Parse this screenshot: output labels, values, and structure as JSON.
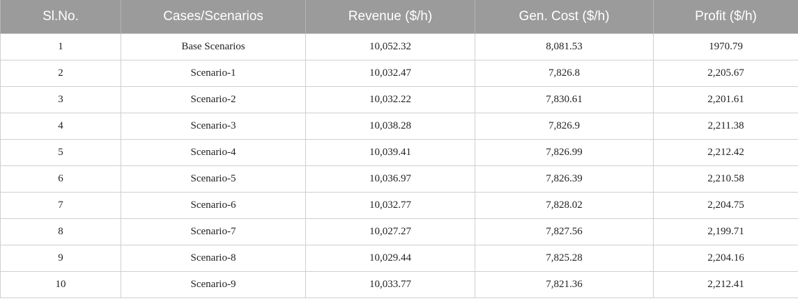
{
  "table": {
    "headers": [
      "Sl.No.",
      "Cases/Scenarios",
      "Revenue ($/h)",
      "Gen. Cost ($/h)",
      "Profit ($/h)"
    ],
    "rows": [
      [
        "1",
        "Base Scenarios",
        "10,052.32",
        "8,081.53",
        "1970.79"
      ],
      [
        "2",
        "Scenario-1",
        "10,032.47",
        "7,826.8",
        "2,205.67"
      ],
      [
        "3",
        "Scenario-2",
        "10,032.22",
        "7,830.61",
        "2,201.61"
      ],
      [
        "4",
        "Scenario-3",
        "10,038.28",
        "7,826.9",
        "2,211.38"
      ],
      [
        "5",
        "Scenario-4",
        "10,039.41",
        "7,826.99",
        "2,212.42"
      ],
      [
        "6",
        "Scenario-5",
        "10,036.97",
        "7,826.39",
        "2,210.58"
      ],
      [
        "7",
        "Scenario-6",
        "10,032.77",
        "7,828.02",
        "2,204.75"
      ],
      [
        "8",
        "Scenario-7",
        "10,027.27",
        "7,827.56",
        "2,199.71"
      ],
      [
        "9",
        "Scenario-8",
        "10,029.44",
        "7,825.28",
        "2,204.16"
      ],
      [
        "10",
        "Scenario-9",
        "10,033.77",
        "7,821.36",
        "2,212.41"
      ]
    ]
  },
  "colors": {
    "header_bg": "#9b9b9b",
    "header_text": "#ffffff",
    "grid": "#cfcfcf"
  }
}
